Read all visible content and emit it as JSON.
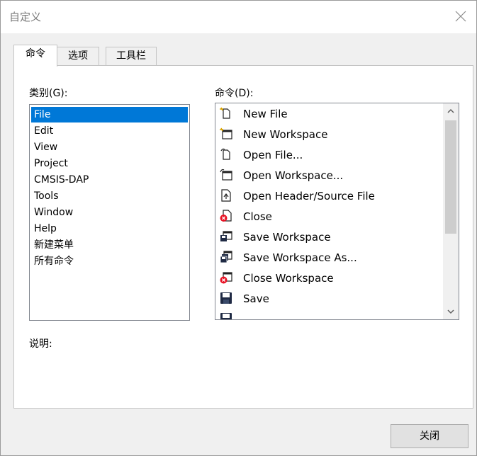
{
  "window": {
    "title": "自定义"
  },
  "tabs": [
    {
      "label": "命令"
    },
    {
      "label": "选项"
    },
    {
      "label": "工具栏"
    }
  ],
  "categories": {
    "label": "类别(G):",
    "items": [
      "File",
      "Edit",
      "View",
      "Project",
      "CMSIS-DAP",
      "Tools",
      "Window",
      "Help",
      "新建菜单",
      "所有命令"
    ],
    "selected": "File"
  },
  "commands": {
    "label": "命令(D):",
    "items": [
      {
        "label": "New File",
        "icon": "new-file-icon"
      },
      {
        "label": "New Workspace",
        "icon": "new-workspace-icon"
      },
      {
        "label": "Open File...",
        "icon": "open-file-icon"
      },
      {
        "label": "Open Workspace...",
        "icon": "open-workspace-icon"
      },
      {
        "label": "Open Header/Source File",
        "icon": "open-header-source-icon"
      },
      {
        "label": "Close",
        "icon": "close-file-icon"
      },
      {
        "label": "Save Workspace",
        "icon": "save-workspace-icon"
      },
      {
        "label": "Save Workspace As...",
        "icon": "save-workspace-as-icon"
      },
      {
        "label": "Close Workspace",
        "icon": "close-workspace-icon"
      },
      {
        "label": "Save",
        "icon": "save-icon"
      }
    ]
  },
  "description": {
    "label": "说明:"
  },
  "buttons": {
    "close": "关闭"
  },
  "colors": {
    "selection": "#0078d7",
    "close_badge": "#e81123"
  }
}
